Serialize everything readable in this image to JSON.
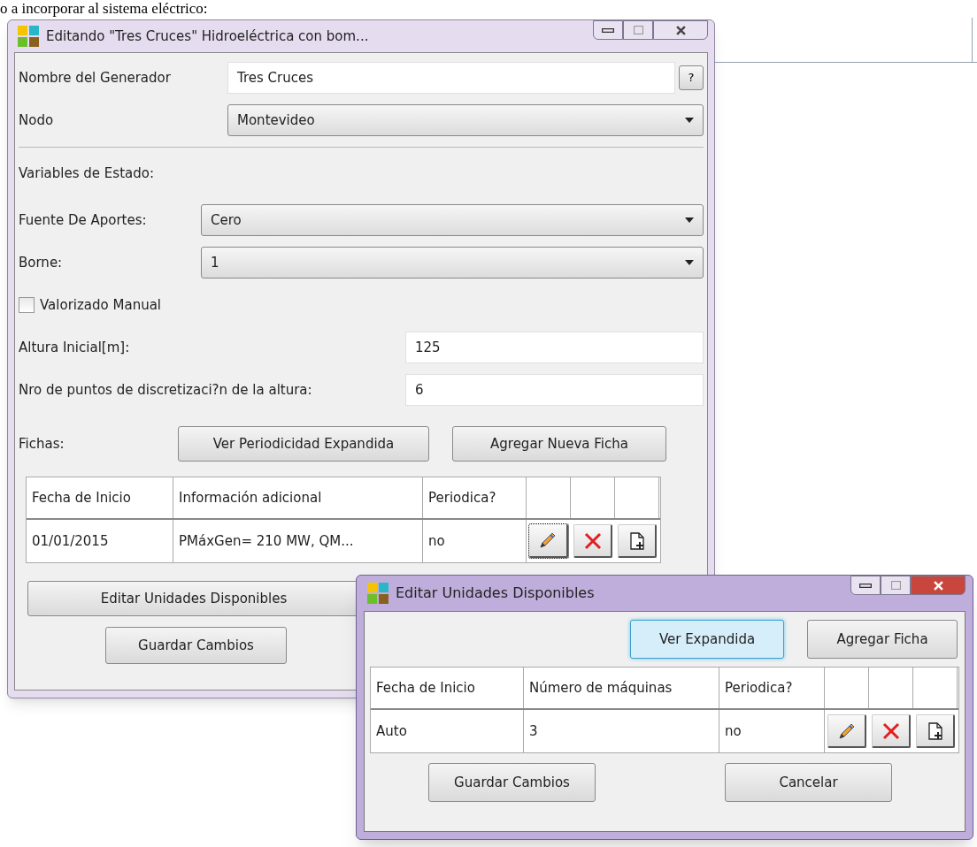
{
  "background_text": "o a incorporar al sistema eléctrico:",
  "main_window": {
    "title": "Editando \"Tres Cruces\" Hidroeléctrica con bom...",
    "help_button": "?",
    "fields": [
      {
        "kind": "text",
        "label": "Nombre del Generador",
        "value": "Tres Cruces"
      },
      {
        "kind": "select",
        "label": "Nodo",
        "value": "Montevideo"
      }
    ],
    "section_label": "Variables de Estado:",
    "state_fields": [
      {
        "kind": "select",
        "label": "Fuente De Aportes:",
        "value": "Cero"
      },
      {
        "kind": "select",
        "label": "Borne:",
        "value": "1"
      },
      {
        "kind": "checkbox",
        "label": "Valorizado Manual",
        "checked": false
      },
      {
        "kind": "text",
        "label": "Altura Inicial[m]:",
        "value": "125"
      },
      {
        "kind": "text",
        "label": "Nro de puntos de discretizaci?n de la altura:",
        "value": "6"
      }
    ],
    "fichas_label": "Fichas:",
    "fichas_buttons": [
      {
        "label": "Ver Periodicidad Expandida",
        "focused": false
      },
      {
        "label": "Agregar Nueva Ficha",
        "focused": false
      }
    ],
    "table": {
      "columns": [
        "Fecha de Inicio",
        "Información adicional",
        "Periodica?"
      ],
      "rows": [
        {
          "cells": [
            "01/01/2015",
            "PMáxGen= 210 MW, QM...",
            "no"
          ],
          "actions": [
            {
              "kind": "edit",
              "focused": true
            },
            {
              "kind": "delete",
              "focused": false
            },
            {
              "kind": "add",
              "focused": false
            }
          ]
        }
      ]
    },
    "bottom_buttons": [
      "Editar Unidades Disponibles",
      "Guardar Cambios"
    ]
  },
  "dialog": {
    "title": "Editar Unidades Disponibles",
    "top_buttons": [
      {
        "label": "Ver Expandida",
        "focused": true
      },
      {
        "label": "Agregar Ficha",
        "focused": false
      }
    ],
    "table": {
      "columns": [
        "Fecha de Inicio",
        "Número de máquinas",
        "Periodica?"
      ],
      "rows": [
        {
          "cells": [
            "Auto",
            "3",
            "no"
          ],
          "actions": [
            {
              "kind": "edit",
              "focused": false
            },
            {
              "kind": "delete",
              "focused": false
            },
            {
              "kind": "add",
              "focused": false
            }
          ]
        }
      ]
    },
    "bottom_buttons": [
      "Guardar Cambios",
      "Cancelar"
    ]
  }
}
